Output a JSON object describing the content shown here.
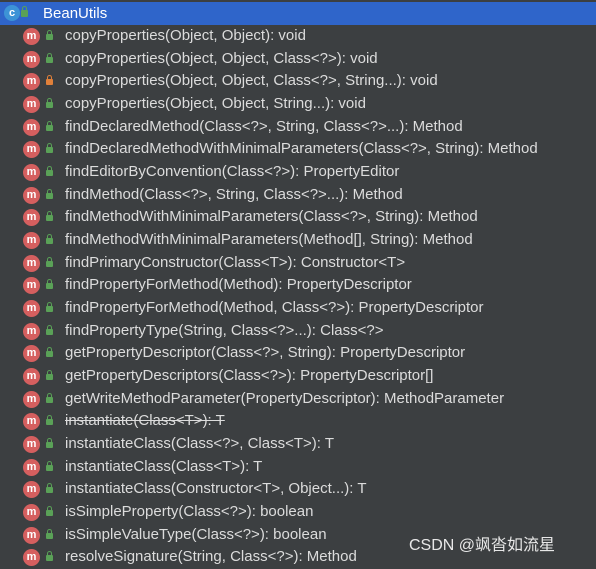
{
  "class_name": "BeanUtils",
  "class_icon_letter": "c",
  "method_icon_letter": "m",
  "methods": [
    {
      "label": "copyProperties(Object, Object): void",
      "access": "public",
      "deprecated": false
    },
    {
      "label": "copyProperties(Object, Object, Class<?>): void",
      "access": "public",
      "deprecated": false
    },
    {
      "label": "copyProperties(Object, Object, Class<?>, String...): void",
      "access": "private",
      "deprecated": false
    },
    {
      "label": "copyProperties(Object, Object, String...): void",
      "access": "public",
      "deprecated": false
    },
    {
      "label": "findDeclaredMethod(Class<?>, String, Class<?>...): Method",
      "access": "public",
      "deprecated": false
    },
    {
      "label": "findDeclaredMethodWithMinimalParameters(Class<?>, String): Method",
      "access": "public",
      "deprecated": false
    },
    {
      "label": "findEditorByConvention(Class<?>): PropertyEditor",
      "access": "public",
      "deprecated": false
    },
    {
      "label": "findMethod(Class<?>, String, Class<?>...): Method",
      "access": "public",
      "deprecated": false
    },
    {
      "label": "findMethodWithMinimalParameters(Class<?>, String): Method",
      "access": "public",
      "deprecated": false
    },
    {
      "label": "findMethodWithMinimalParameters(Method[], String): Method",
      "access": "public",
      "deprecated": false
    },
    {
      "label": "findPrimaryConstructor(Class<T>): Constructor<T>",
      "access": "public",
      "deprecated": false
    },
    {
      "label": "findPropertyForMethod(Method): PropertyDescriptor",
      "access": "public",
      "deprecated": false
    },
    {
      "label": "findPropertyForMethod(Method, Class<?>): PropertyDescriptor",
      "access": "public",
      "deprecated": false
    },
    {
      "label": "findPropertyType(String, Class<?>...): Class<?>",
      "access": "public",
      "deprecated": false
    },
    {
      "label": "getPropertyDescriptor(Class<?>, String): PropertyDescriptor",
      "access": "public",
      "deprecated": false
    },
    {
      "label": "getPropertyDescriptors(Class<?>): PropertyDescriptor[]",
      "access": "public",
      "deprecated": false
    },
    {
      "label": "getWriteMethodParameter(PropertyDescriptor): MethodParameter",
      "access": "public",
      "deprecated": false
    },
    {
      "label": "instantiate(Class<T>): T",
      "access": "public",
      "deprecated": true
    },
    {
      "label": "instantiateClass(Class<?>, Class<T>): T",
      "access": "public",
      "deprecated": false
    },
    {
      "label": "instantiateClass(Class<T>): T",
      "access": "public",
      "deprecated": false
    },
    {
      "label": "instantiateClass(Constructor<T>, Object...): T",
      "access": "public",
      "deprecated": false
    },
    {
      "label": "isSimpleProperty(Class<?>): boolean",
      "access": "public",
      "deprecated": false
    },
    {
      "label": "isSimpleValueType(Class<?>): boolean",
      "access": "public",
      "deprecated": false
    },
    {
      "label": "resolveSignature(String, Class<?>): Method",
      "access": "public",
      "deprecated": false
    }
  ],
  "watermark": "CSDN @飒沓如流星",
  "colors": {
    "background": "#3c3f41",
    "header_selection": "#2f65ca",
    "method_icon": "#d55f5f",
    "public_lock": "#5aa157",
    "private_lock": "#e0803a",
    "text": "#dcdcdc"
  }
}
